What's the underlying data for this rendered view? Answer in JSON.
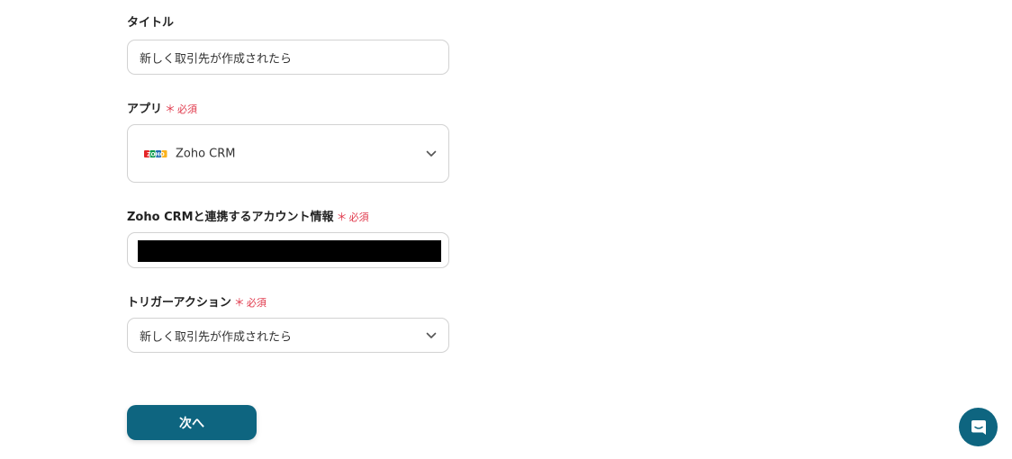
{
  "form": {
    "title": {
      "label": "タイトル",
      "value": "新しく取引先が作成されたら"
    },
    "app": {
      "label": "アプリ",
      "required_mark": "＊",
      "required_text": "必須",
      "value": "Zoho CRM",
      "logo_icon": "zoho-logo-icon"
    },
    "account": {
      "label": "Zoho CRMと連携するアカウント情報",
      "required_mark": "＊",
      "required_text": "必須"
    },
    "trigger": {
      "label": "トリガーアクション",
      "required_mark": "＊",
      "required_text": "必須",
      "value": "新しく取引先が作成されたら"
    }
  },
  "actions": {
    "next_label": "次へ"
  },
  "colors": {
    "primary": "#0e6580",
    "required": "#e0384b",
    "border": "#d2d2d2"
  }
}
